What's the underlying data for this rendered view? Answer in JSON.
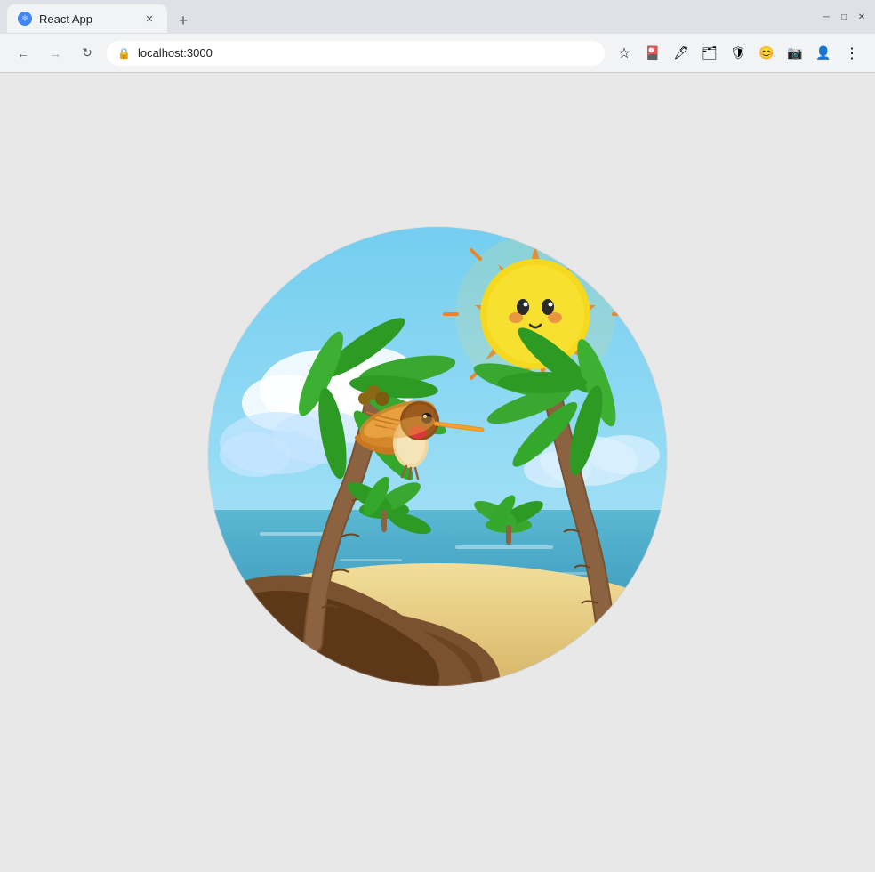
{
  "browser": {
    "tab_title": "React App",
    "tab_favicon": "⚛",
    "url": "localhost:3000",
    "nav": {
      "back_disabled": false,
      "forward_disabled": true
    }
  },
  "scene": {
    "description": "Tropical beach scene with hummingbird, palm trees, sun, and ocean"
  }
}
